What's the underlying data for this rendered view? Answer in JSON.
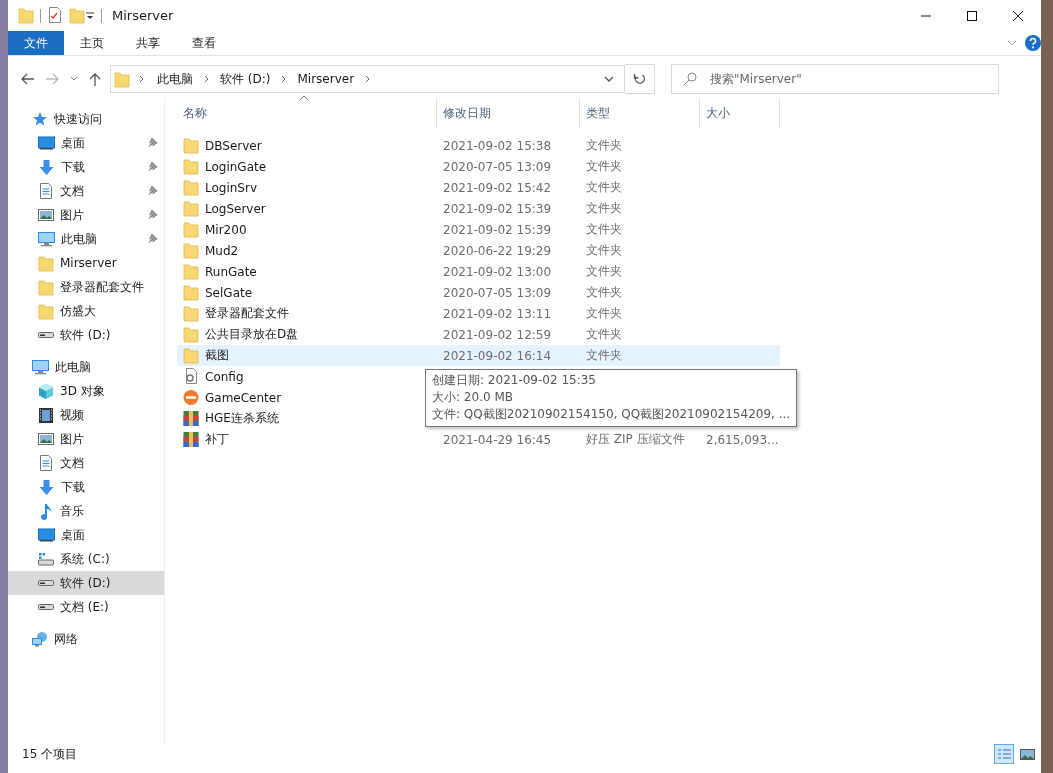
{
  "window": {
    "title": "Mirserver"
  },
  "ribbon": {
    "tabs": [
      {
        "label": "文件",
        "selected": true
      },
      {
        "label": "主页",
        "selected": false
      },
      {
        "label": "共享",
        "selected": false
      },
      {
        "label": "查看",
        "selected": false
      }
    ]
  },
  "address": {
    "path": [
      "此电脑",
      "软件 (D:)",
      "Mirserver"
    ]
  },
  "search": {
    "placeholder": "搜索\"Mirserver\""
  },
  "columns": [
    "名称",
    "修改日期",
    "类型",
    "大小"
  ],
  "sidebar": {
    "items": [
      {
        "label": "快速访问",
        "kind": "star",
        "selected": false,
        "children": [
          {
            "label": "桌面",
            "kind": "desktop",
            "pinned": true,
            "selected": false
          },
          {
            "label": "下载",
            "kind": "download",
            "pinned": true,
            "selected": false
          },
          {
            "label": "文档",
            "kind": "document",
            "pinned": true,
            "selected": false
          },
          {
            "label": "图片",
            "kind": "picture",
            "pinned": true,
            "selected": false
          },
          {
            "label": "此电脑",
            "kind": "pc",
            "pinned": true,
            "selected": false
          },
          {
            "label": "Mirserver",
            "kind": "folder",
            "pinned": false,
            "selected": false
          },
          {
            "label": "登录器配套文件",
            "kind": "folder",
            "pinned": false,
            "selected": false
          },
          {
            "label": "仿盛大",
            "kind": "folder",
            "pinned": false,
            "selected": false
          },
          {
            "label": "软件 (D:)",
            "kind": "drive",
            "pinned": false,
            "selected": false
          }
        ]
      },
      {
        "label": "此电脑",
        "kind": "pc",
        "selected": false,
        "children": [
          {
            "label": "3D 对象",
            "kind": "cube",
            "selected": false
          },
          {
            "label": "视频",
            "kind": "video",
            "selected": false
          },
          {
            "label": "图片",
            "kind": "picture",
            "selected": false
          },
          {
            "label": "文档",
            "kind": "document",
            "selected": false
          },
          {
            "label": "下载",
            "kind": "download",
            "selected": false
          },
          {
            "label": "音乐",
            "kind": "music",
            "selected": false
          },
          {
            "label": "桌面",
            "kind": "desktop",
            "selected": false
          },
          {
            "label": "系统 (C:)",
            "kind": "sysdrive",
            "selected": false
          },
          {
            "label": "软件 (D:)",
            "kind": "drive",
            "selected": true
          },
          {
            "label": "文档 (E:)",
            "kind": "drive",
            "selected": false
          }
        ]
      },
      {
        "label": "网络",
        "kind": "network",
        "selected": false
      }
    ]
  },
  "files": [
    {
      "name": "DBServer",
      "kind": "folder",
      "modified": "2021-09-02 15:38",
      "type": "文件夹",
      "hovered": false
    },
    {
      "name": "LoginGate",
      "kind": "folder",
      "modified": "2020-07-05 13:09",
      "type": "文件夹",
      "hovered": false
    },
    {
      "name": "LoginSrv",
      "kind": "folder",
      "modified": "2021-09-02 15:42",
      "type": "文件夹",
      "hovered": false
    },
    {
      "name": "LogServer",
      "kind": "folder",
      "modified": "2021-09-02 15:39",
      "type": "文件夹",
      "hovered": false
    },
    {
      "name": "Mir200",
      "kind": "folder",
      "modified": "2021-09-02 15:39",
      "type": "文件夹",
      "hovered": false
    },
    {
      "name": "Mud2",
      "kind": "folder",
      "modified": "2020-06-22 19:29",
      "type": "文件夹",
      "hovered": false
    },
    {
      "name": "RunGate",
      "kind": "folder",
      "modified": "2021-09-02 13:00",
      "type": "文件夹",
      "hovered": false
    },
    {
      "name": "SelGate",
      "kind": "folder",
      "modified": "2020-07-05 13:09",
      "type": "文件夹",
      "hovered": false
    },
    {
      "name": "登录器配套文件",
      "kind": "folder",
      "modified": "2021-09-02 13:11",
      "type": "文件夹",
      "hovered": false
    },
    {
      "name": "公共目录放在D盘",
      "kind": "folder",
      "modified": "2021-09-02 12:59",
      "type": "文件夹",
      "hovered": false
    },
    {
      "name": "截图",
      "kind": "folder",
      "modified": "2021-09-02 16:14",
      "type": "文件夹",
      "hovered": true
    },
    {
      "name": "Config",
      "kind": "config",
      "hovered": false
    },
    {
      "name": "GameCenter",
      "kind": "app",
      "hovered": false
    },
    {
      "name": "HGE连杀系统",
      "kind": "archive",
      "hovered": false
    },
    {
      "name": "补丁",
      "kind": "archive",
      "modified": "2021-04-29 16:45",
      "type": "好压 ZIP 压缩文件",
      "size": "2,615,093...",
      "hovered": false
    }
  ],
  "tooltip": {
    "lines": [
      "创建日期: 2021-09-02 15:35",
      "大小: 20.0 MB",
      "文件: QQ截图20210902154150, QQ截图20210902154209, ..."
    ]
  },
  "status_bar": {
    "count": "15 个项目",
    "views": [
      {
        "kind": "details",
        "selected": true
      },
      {
        "kind": "thumbnails",
        "selected": false
      }
    ]
  }
}
